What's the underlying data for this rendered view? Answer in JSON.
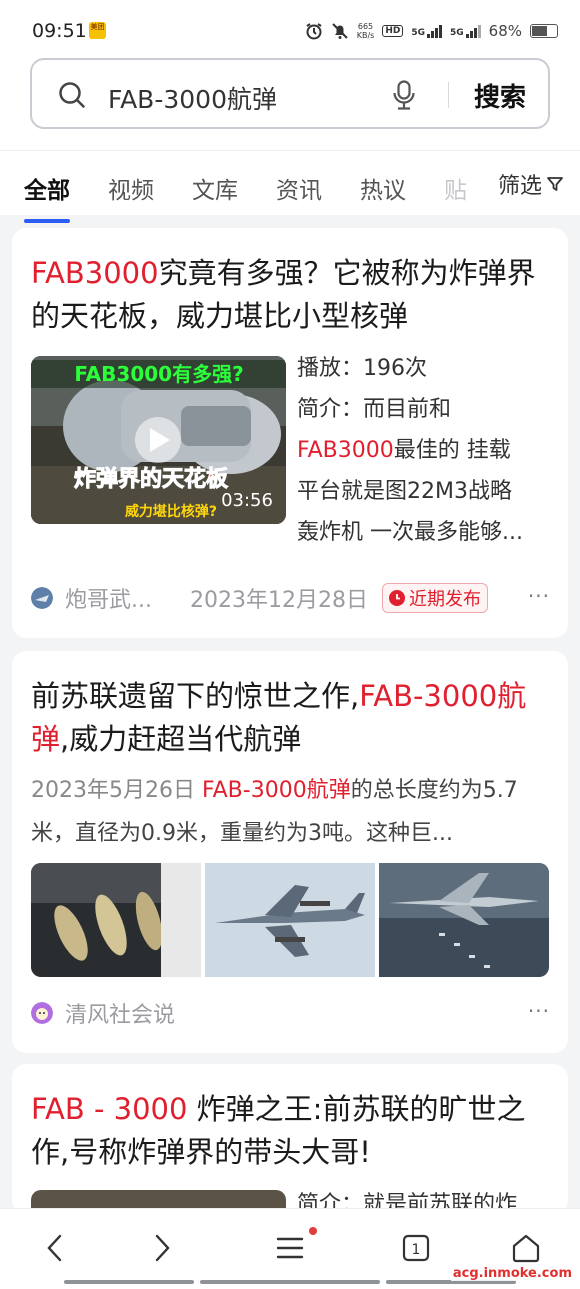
{
  "status": {
    "time": "09:51",
    "app_badge": "美团",
    "net_speed": "665",
    "net_unit": "KB/s",
    "hd": "HD",
    "net1": "5G",
    "net2": "5G",
    "battery": "68%"
  },
  "search": {
    "query": "FAB-3000航弹",
    "button": "搜索"
  },
  "tabs": [
    {
      "label": "全部"
    },
    {
      "label": "视频"
    },
    {
      "label": "文库"
    },
    {
      "label": "资讯"
    },
    {
      "label": "热议"
    },
    {
      "label": "贴"
    }
  ],
  "filter_label": "筛选",
  "results": [
    {
      "title_hl": "FAB3000",
      "title_rest": "究竟有多强？它被称为炸弹界的天花板，威力堪比小型核弹",
      "thumb_top_text": "FAB3000有多强?",
      "thumb_mid_text": "炸弹界的天花板",
      "thumb_bottom_text": "威力堪比核弹?",
      "duration": "03:56",
      "plays": "播放：196次",
      "desc_line1": "简介：而目前和",
      "desc_hl": "FAB3000",
      "desc_line2_rest": "最佳的 挂载",
      "desc_line3": "平台就是图22M3战略",
      "desc_line4": "轰炸机 一次最多能够...",
      "source": "炮哥武...",
      "date": "2023年12月28日",
      "badge": "近期发布",
      "more": "···"
    },
    {
      "title_part1": "前苏联遗留下的惊世之作,",
      "title_hl1": "FAB-3000",
      "title_hl2": "航弹",
      "title_part2": ",威力赶超当代航弹",
      "snippet_date": "2023年5月26日",
      "snippet_hl": "FAB-3000航弹",
      "snippet_rest": "的总长度约为5.7米，直径为0.9米，重量约为3吨。这种巨...",
      "source": "清风社会说",
      "more": "···"
    },
    {
      "title_hl": "FAB - 3000",
      "title_rest": " 炸弹之王:前苏联的旷世之作,号称炸弹界的带头大哥!",
      "partial_desc": "简介：就是前苏联的炸"
    }
  ],
  "watermark": "acg.inmoke.com",
  "colors": {
    "highlight": "#e0202f",
    "accent": "#2d5ef4",
    "background": "#f3f4f6"
  }
}
